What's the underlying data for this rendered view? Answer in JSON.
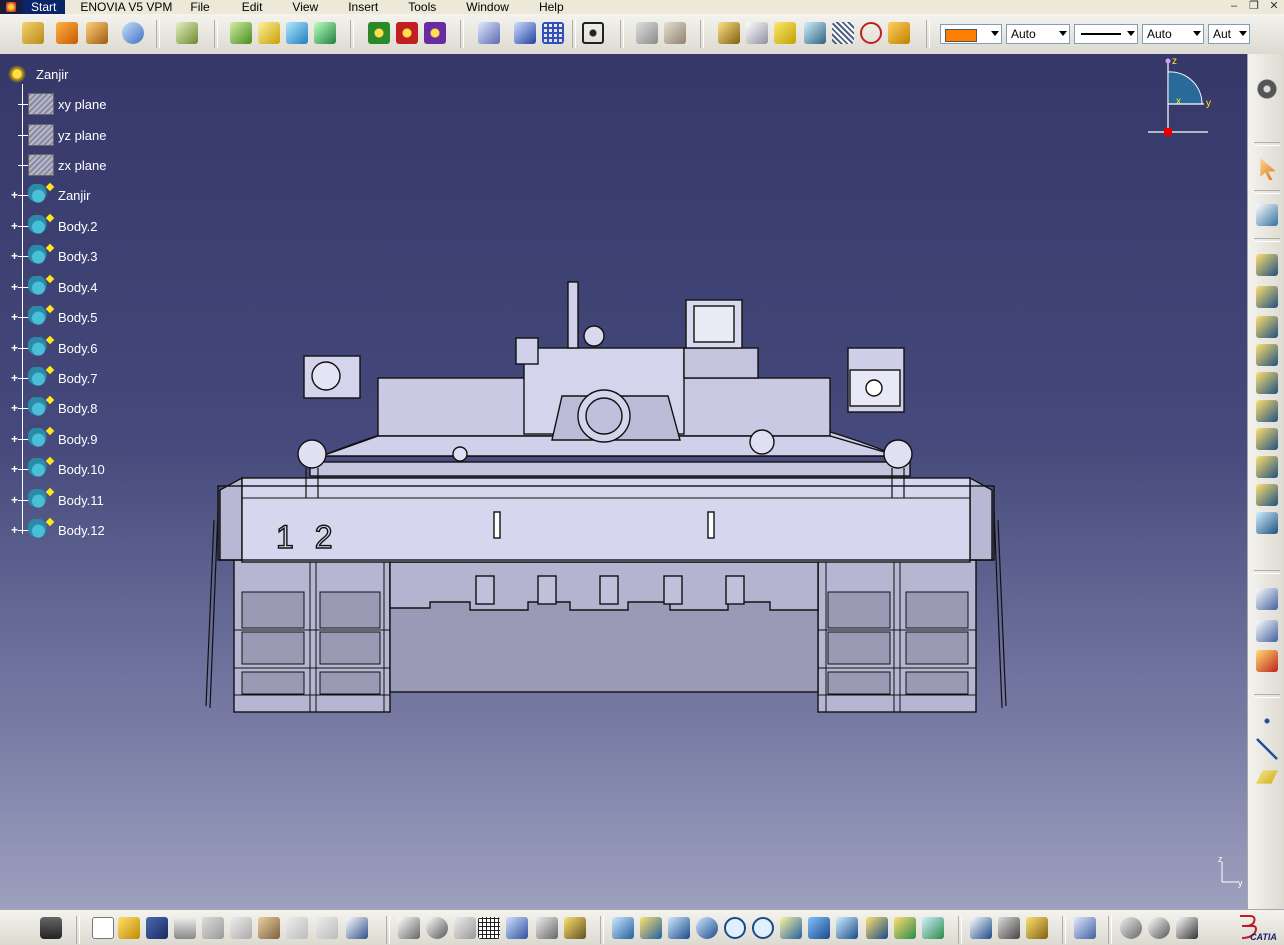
{
  "menubar": {
    "items": [
      "Start",
      "ENOVIA V5 VPM",
      "File",
      "Edit",
      "View",
      "Insert",
      "Tools",
      "Window",
      "Help"
    ]
  },
  "graphic_properties": {
    "fill_color": "#ff8000",
    "transparency": "Auto",
    "line_type": "solid",
    "thickness": "Auto",
    "linetype_combo": "Aut"
  },
  "tree": {
    "root": "Zanjir",
    "planes": [
      "xy plane",
      "yz plane",
      "zx plane"
    ],
    "part_body": "Zanjir",
    "bodies": [
      "Body.2",
      "Body.3",
      "Body.4",
      "Body.5",
      "Body.6",
      "Body.7",
      "Body.8",
      "Body.9",
      "Body.10",
      "Body.11",
      "Body.12"
    ]
  },
  "compass": {
    "x_label": "x",
    "y_label": "y",
    "z_label": "z"
  },
  "model": {
    "hull_number": "1 2"
  },
  "view_axis": {
    "z_label": "z",
    "y_label": "y"
  },
  "brand": {
    "name": "CATIA"
  },
  "colors": {
    "viewport_top": "#353868",
    "viewport_bottom": "#9da0be",
    "accent": "#ff8000"
  }
}
